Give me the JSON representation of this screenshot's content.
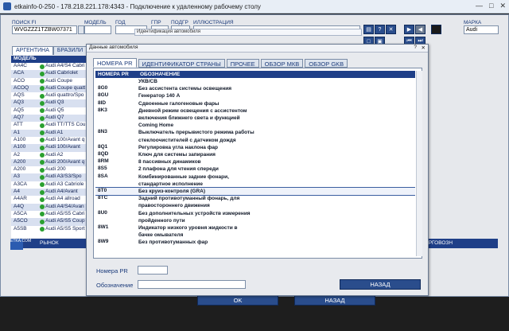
{
  "window": {
    "title": "etkainfo-0-250 - 178.218.221.178:4343 - Подключение к удаленному рабочему столу"
  },
  "top": {
    "labels": [
      "ПОИСК FI",
      "МОДЕЛЬ",
      "ГОД",
      "ГПР",
      "ПОДГР",
      "ИЛЛЮСТРАЦИЯ",
      "МАРКА"
    ],
    "vin": "WVGZZZ1TZBW07371",
    "brand": "Audi",
    "ident_hint": "Идентификация автомобиля"
  },
  "region_tabs": [
    "АРГЕНТИНА",
    "БРАЗИЛИ"
  ],
  "models": {
    "header": "МОДЕЛЬ",
    "rows": [
      {
        "code": "AA4C",
        "name": "Audi A4/S4 Cabri"
      },
      {
        "code": "ACA",
        "name": "Audi Cabriolet"
      },
      {
        "code": "ACO",
        "name": "Audi Coupe"
      },
      {
        "code": "ACOQ",
        "name": "Audi Coupe quatt"
      },
      {
        "code": "AQS",
        "name": "Audi quattro/Spo"
      },
      {
        "code": "AQ3",
        "name": "Audi Q3"
      },
      {
        "code": "AQ5",
        "name": "Audi Q5"
      },
      {
        "code": "AQ7",
        "name": "Audi Q7"
      },
      {
        "code": "ATT",
        "name": "Audi TT/TTS Cou"
      },
      {
        "code": "A1",
        "name": "Audi A1"
      },
      {
        "code": "A100",
        "name": "Audi 100/Avant q"
      },
      {
        "code": "A100",
        "name": "Audi 100/Avant"
      },
      {
        "code": "A2",
        "name": "Audi A2"
      },
      {
        "code": "A200",
        "name": "Audi 200/Avant q"
      },
      {
        "code": "A200",
        "name": "Audi 200"
      },
      {
        "code": "A3",
        "name": "Audi A3/S3/Spo"
      },
      {
        "code": "A3CA",
        "name": "Audi A3 Cabriole"
      },
      {
        "code": "A4",
        "name": "Audi A4/Avant"
      },
      {
        "code": "A4AR",
        "name": "Audi A4 allroad"
      },
      {
        "code": "A4Q",
        "name": "Audi A4/S4/Avan"
      },
      {
        "code": "A5CA",
        "name": "Audi A5/S5 Cabri"
      },
      {
        "code": "A5CO",
        "name": "Audi A5/S5 Coup"
      },
      {
        "code": "A5SB",
        "name": "Audi A5/S5 Sport"
      }
    ]
  },
  "bottom": {
    "left": "РЫНОК",
    "right": "ЯРГОВОЗН",
    "logo": "ETKA.COM"
  },
  "dialog": {
    "title": "Данные автомобиля",
    "tabs": [
      "НОМЕРА PR",
      "ИДЕНТИФИКАТОР СТРАНЫ",
      "ПРОЧЕЕ",
      "ОБЗОР МКВ",
      "ОБЗОР GKB"
    ],
    "col1": "НОМЕРА PR",
    "col2": "ОБОЗНАЧЕНИЕ",
    "rows": [
      {
        "code": "",
        "desc": [
          "УКВ/CB"
        ]
      },
      {
        "code": "8G0",
        "desc": [
          "Без ассистента системы освещения"
        ]
      },
      {
        "code": "8GU",
        "desc": [
          "Генератор 140 A"
        ]
      },
      {
        "code": "8ID",
        "desc": [
          "Сдвоенные галогеновые фары"
        ]
      },
      {
        "code": "8K3",
        "desc": [
          "Дневной режим освещения с ассистентом",
          "включения ближнего света и функцией",
          "Coming Home"
        ]
      },
      {
        "code": "8N3",
        "desc": [
          "Выключатель прерывистого режима работы",
          "стеклоочистителей с датчиком дождя"
        ]
      },
      {
        "code": "8Q1",
        "desc": [
          "Регулировка угла наклона фар"
        ]
      },
      {
        "code": "8QD",
        "desc": [
          "Ключ для системы запирания"
        ]
      },
      {
        "code": "8RM",
        "desc": [
          "8 пассивных динамиков"
        ]
      },
      {
        "code": "8S5",
        "desc": [
          "2 плафона для чтения спереди"
        ]
      },
      {
        "code": "8SA",
        "desc": [
          "Комбинированные задние фонари,",
          "стандартное исполнение"
        ]
      },
      {
        "code": "8T0",
        "desc": [
          "Без круиз-контроля (GRA)"
        ]
      },
      {
        "code": "8TC",
        "desc": [
          "Задний противотуманный фонарь, для",
          "правостороннего движения"
        ]
      },
      {
        "code": "8U0",
        "desc": [
          "Без дополнительных устройств измерения",
          "пройденного пути"
        ]
      },
      {
        "code": "8W1",
        "desc": [
          "Индикатор низкого уровня жидкости в",
          "бачке омывателя"
        ]
      },
      {
        "code": "8W9",
        "desc": [
          "Без противотуманных фар"
        ]
      }
    ],
    "pr_label": "Номера PR",
    "desc_label": "Обозначение",
    "back_btn": "НАЗАД"
  },
  "outer_buttons": {
    "ok": "OK",
    "back": "НАЗАД"
  }
}
